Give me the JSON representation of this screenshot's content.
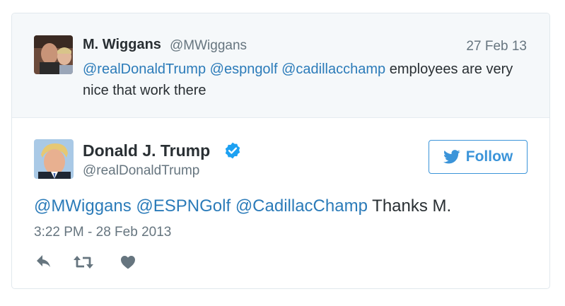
{
  "parent_tweet": {
    "name": "M. Wiggans",
    "handle": "@MWiggans",
    "date": "27 Feb 13",
    "mentions": [
      "@realDonaldTrump",
      "@espngolf",
      "@cadillacchamp"
    ],
    "text_rest": "employees are very nice that work there"
  },
  "tweet": {
    "name": "Donald J. Trump",
    "handle": "@realDonaldTrump",
    "verified": true,
    "follow_label": "Follow",
    "mentions": [
      "@MWiggans",
      "@ESPNGolf",
      "@CadillacChamp"
    ],
    "text_rest": "Thanks M.",
    "timestamp": "3:22 PM - 28 Feb 2013"
  },
  "actions": [
    {
      "name": "reply",
      "icon": "reply-icon"
    },
    {
      "name": "retweet",
      "icon": "retweet-icon"
    },
    {
      "name": "like",
      "icon": "heart-icon"
    }
  ],
  "colors": {
    "link": "#2b7bb9",
    "follow": "#3b94d9",
    "muted": "#66757f",
    "icon": "#8899a6",
    "parent_bg": "#f5f8fa"
  }
}
